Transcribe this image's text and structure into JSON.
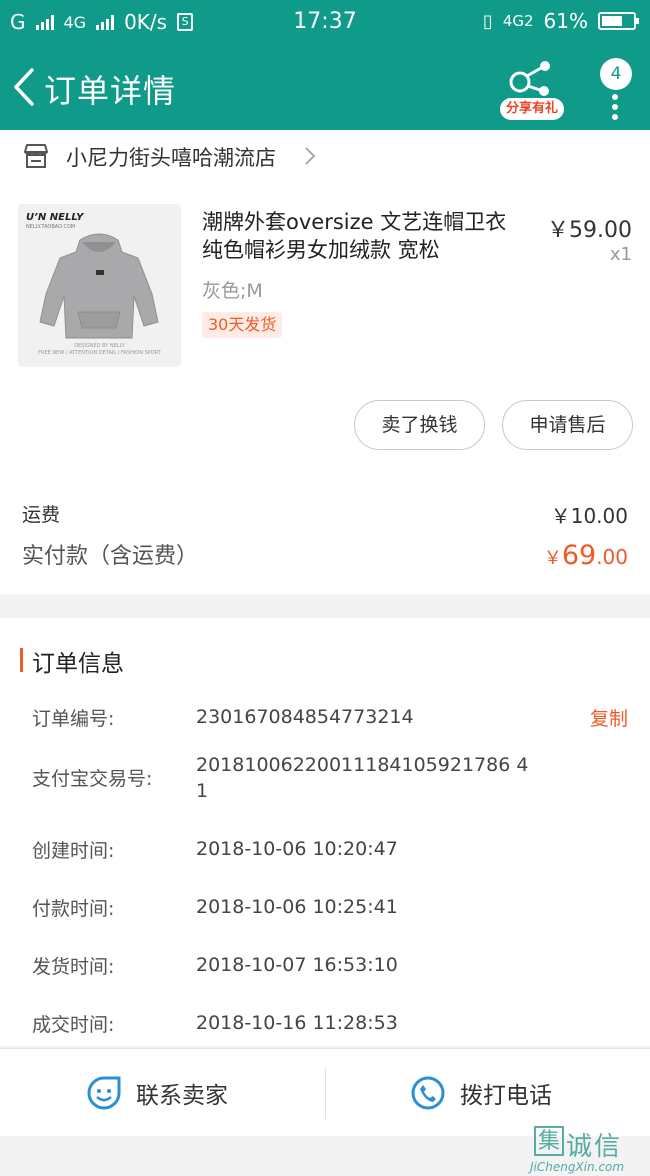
{
  "status": {
    "carrier_left": "G",
    "network1": "4G",
    "speed": "0K/s",
    "time": "17:37",
    "network2": "4G2",
    "battery": "61%"
  },
  "nav": {
    "title": "订单详情",
    "share_label": "分享有礼",
    "badge_count": "4"
  },
  "shop": {
    "name": "小尼力街头嘻哈潮流店"
  },
  "product": {
    "brand": "U’N NELLY",
    "brand_sub": "NELLY.TAOBAO.COM",
    "img_foot": "DESIGNED BY NELLY\nFREE NEW  /  ATTENTION DETAIL  /  FASHION SPORT",
    "title": "潮牌外套oversize 文艺连帽卫衣 纯色帽衫男女加绒款 宽松",
    "price": "￥59.00",
    "qty": "x1",
    "sku": "灰色;M",
    "tag": "30天发货"
  },
  "actions": {
    "sell": "卖了换钱",
    "after_sale": "申请售后"
  },
  "fees": {
    "shipping_label": "运费",
    "shipping_value": "￥10.00",
    "paid_label": "实付款（含运费）",
    "paid_currency": "￥",
    "paid_int": "69",
    "paid_dec": ".00"
  },
  "info": {
    "heading": "订单信息",
    "copy_label": "复制",
    "rows": [
      {
        "key": "订单编号:",
        "value": "230167084854773214"
      },
      {
        "key": "支付宝交易号:",
        "value": "20181006220011184105921786 41"
      },
      {
        "key": "创建时间:",
        "value": "2018-10-06 10:20:47"
      },
      {
        "key": "付款时间:",
        "value": "2018-10-06 10:25:41"
      },
      {
        "key": "发货时间:",
        "value": "2018-10-07 16:53:10"
      },
      {
        "key": "成交时间:",
        "value": "2018-10-16 11:28:53"
      }
    ]
  },
  "bottom": {
    "contact_seller": "联系卖家",
    "call_phone": "拨打电话"
  },
  "watermark": {
    "chars": [
      "集",
      "诚",
      "信"
    ],
    "url": "JiChengXin.com"
  },
  "colors": {
    "brand_teal": "#0f9a8a",
    "accent_orange": "#f05a28"
  }
}
